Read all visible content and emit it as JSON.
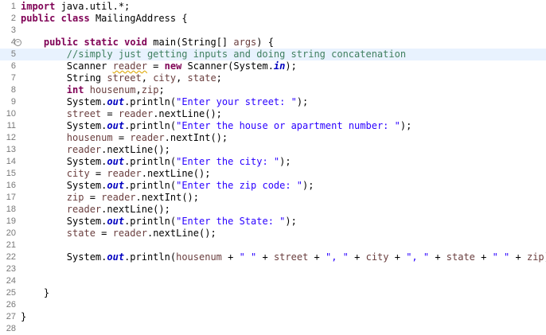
{
  "editor": {
    "file_class": "MailingAddress",
    "current_line": 5,
    "lines": [
      {
        "n": "1",
        "tokens": [
          [
            "kw",
            "import"
          ],
          [
            "plain",
            " java.util.*;"
          ]
        ]
      },
      {
        "n": "2",
        "tokens": [
          [
            "kw",
            "public"
          ],
          [
            "plain",
            " "
          ],
          [
            "kw",
            "class"
          ],
          [
            "plain",
            " MailingAddress {"
          ]
        ]
      },
      {
        "n": "3",
        "tokens": []
      },
      {
        "n": "4",
        "fold": true,
        "tokens": [
          [
            "plain",
            "    "
          ],
          [
            "kw",
            "public"
          ],
          [
            "plain",
            " "
          ],
          [
            "kw",
            "static"
          ],
          [
            "plain",
            " "
          ],
          [
            "kw",
            "void"
          ],
          [
            "plain",
            " main(String[] "
          ],
          [
            "var",
            "args"
          ],
          [
            "plain",
            ") {"
          ]
        ]
      },
      {
        "n": "5",
        "tokens": [
          [
            "plain",
            "        "
          ],
          [
            "cm",
            "//simply just getting inputs and doing string concatenation"
          ]
        ]
      },
      {
        "n": "6",
        "tokens": [
          [
            "plain",
            "        Scanner "
          ],
          [
            "var warn",
            "reader"
          ],
          [
            "plain",
            " = "
          ],
          [
            "kw",
            "new"
          ],
          [
            "plain",
            " Scanner(System."
          ],
          [
            "fld",
            "in"
          ],
          [
            "plain",
            ");"
          ]
        ]
      },
      {
        "n": "7",
        "tokens": [
          [
            "plain",
            "        String "
          ],
          [
            "var",
            "street"
          ],
          [
            "plain",
            ", "
          ],
          [
            "var",
            "city"
          ],
          [
            "plain",
            ", "
          ],
          [
            "var",
            "state"
          ],
          [
            "plain",
            ";"
          ]
        ]
      },
      {
        "n": "8",
        "tokens": [
          [
            "plain",
            "        "
          ],
          [
            "kw",
            "int"
          ],
          [
            "plain",
            " "
          ],
          [
            "var",
            "housenum"
          ],
          [
            "plain",
            ","
          ],
          [
            "var",
            "zip"
          ],
          [
            "plain",
            ";"
          ]
        ]
      },
      {
        "n": "9",
        "tokens": [
          [
            "plain",
            "        System."
          ],
          [
            "fld",
            "out"
          ],
          [
            "plain",
            ".println("
          ],
          [
            "str",
            "\"Enter your street: \""
          ],
          [
            "plain",
            ");"
          ]
        ]
      },
      {
        "n": "10",
        "tokens": [
          [
            "plain",
            "        "
          ],
          [
            "var",
            "street"
          ],
          [
            "plain",
            " = "
          ],
          [
            "var",
            "reader"
          ],
          [
            "plain",
            ".nextLine();"
          ]
        ]
      },
      {
        "n": "11",
        "tokens": [
          [
            "plain",
            "        System."
          ],
          [
            "fld",
            "out"
          ],
          [
            "plain",
            ".println("
          ],
          [
            "str",
            "\"Enter the house or apartment number: \""
          ],
          [
            "plain",
            ");"
          ]
        ]
      },
      {
        "n": "12",
        "tokens": [
          [
            "plain",
            "        "
          ],
          [
            "var",
            "housenum"
          ],
          [
            "plain",
            " = "
          ],
          [
            "var",
            "reader"
          ],
          [
            "plain",
            ".nextInt();"
          ]
        ]
      },
      {
        "n": "13",
        "tokens": [
          [
            "plain",
            "        "
          ],
          [
            "var",
            "reader"
          ],
          [
            "plain",
            ".nextLine();"
          ]
        ]
      },
      {
        "n": "14",
        "tokens": [
          [
            "plain",
            "        System."
          ],
          [
            "fld",
            "out"
          ],
          [
            "plain",
            ".println("
          ],
          [
            "str",
            "\"Enter the city: \""
          ],
          [
            "plain",
            ");"
          ]
        ]
      },
      {
        "n": "15",
        "tokens": [
          [
            "plain",
            "        "
          ],
          [
            "var",
            "city"
          ],
          [
            "plain",
            " = "
          ],
          [
            "var",
            "reader"
          ],
          [
            "plain",
            ".nextLine();"
          ]
        ]
      },
      {
        "n": "16",
        "tokens": [
          [
            "plain",
            "        System."
          ],
          [
            "fld",
            "out"
          ],
          [
            "plain",
            ".println("
          ],
          [
            "str",
            "\"Enter the zip code: \""
          ],
          [
            "plain",
            ");"
          ]
        ]
      },
      {
        "n": "17",
        "tokens": [
          [
            "plain",
            "        "
          ],
          [
            "var",
            "zip"
          ],
          [
            "plain",
            " = "
          ],
          [
            "var",
            "reader"
          ],
          [
            "plain",
            ".nextInt();"
          ]
        ]
      },
      {
        "n": "18",
        "tokens": [
          [
            "plain",
            "        "
          ],
          [
            "var",
            "reader"
          ],
          [
            "plain",
            ".nextLine();"
          ]
        ]
      },
      {
        "n": "19",
        "tokens": [
          [
            "plain",
            "        System."
          ],
          [
            "fld",
            "out"
          ],
          [
            "plain",
            ".println("
          ],
          [
            "str",
            "\"Enter the State: \""
          ],
          [
            "plain",
            ");"
          ]
        ]
      },
      {
        "n": "20",
        "tokens": [
          [
            "plain",
            "        "
          ],
          [
            "var",
            "state"
          ],
          [
            "plain",
            " = "
          ],
          [
            "var",
            "reader"
          ],
          [
            "plain",
            ".nextLine();"
          ]
        ]
      },
      {
        "n": "21",
        "tokens": []
      },
      {
        "n": "22",
        "tokens": [
          [
            "plain",
            "        System."
          ],
          [
            "fld",
            "out"
          ],
          [
            "plain",
            ".println("
          ],
          [
            "var",
            "housenum"
          ],
          [
            "plain",
            " + "
          ],
          [
            "str",
            "\" \""
          ],
          [
            "plain",
            " + "
          ],
          [
            "var",
            "street"
          ],
          [
            "plain",
            " + "
          ],
          [
            "str",
            "\", \""
          ],
          [
            "plain",
            " + "
          ],
          [
            "var",
            "city"
          ],
          [
            "plain",
            " + "
          ],
          [
            "str",
            "\", \""
          ],
          [
            "plain",
            " + "
          ],
          [
            "var",
            "state"
          ],
          [
            "plain",
            " + "
          ],
          [
            "str",
            "\" \""
          ],
          [
            "plain",
            " + "
          ],
          [
            "var",
            "zip"
          ],
          [
            "plain",
            ");"
          ]
        ]
      },
      {
        "n": "23",
        "tokens": []
      },
      {
        "n": "24",
        "tokens": []
      },
      {
        "n": "25",
        "tokens": [
          [
            "plain",
            "    }"
          ]
        ]
      },
      {
        "n": "26",
        "tokens": []
      },
      {
        "n": "27",
        "tokens": [
          [
            "plain",
            "}"
          ]
        ]
      },
      {
        "n": "28",
        "tokens": []
      }
    ]
  }
}
